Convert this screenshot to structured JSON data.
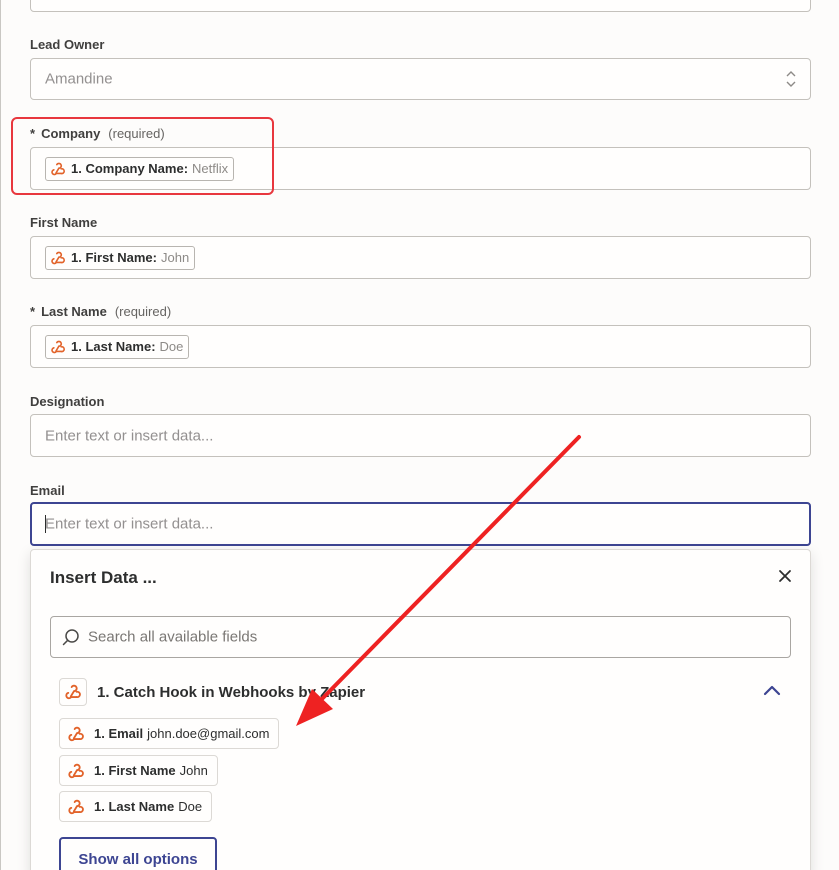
{
  "fields": {
    "lead_owner": {
      "label": "Lead Owner",
      "value": "Amandine"
    },
    "company": {
      "star": "*",
      "label": "Company",
      "required_note": "(required)",
      "pill": {
        "key": "1. Company Name:",
        "value": "Netflix"
      }
    },
    "first_name": {
      "label": "First Name",
      "pill": {
        "key": "1. First Name:",
        "value": "John"
      }
    },
    "last_name": {
      "star": "*",
      "label": "Last Name",
      "required_note": "(required)",
      "pill": {
        "key": "1. Last Name:",
        "value": "Doe"
      }
    },
    "designation": {
      "label": "Designation",
      "placeholder": "Enter text or insert data..."
    },
    "email": {
      "label": "Email",
      "placeholder": "Enter text or insert data..."
    }
  },
  "insert_data": {
    "title": "Insert Data ...",
    "search_placeholder": "Search all available fields",
    "source_title": "1. Catch Hook in Webhooks by Zapier",
    "items": [
      {
        "key": "1. Email",
        "value": "john.doe@gmail.com"
      },
      {
        "key": "1. First Name",
        "value": "John"
      },
      {
        "key": "1. Last Name",
        "value": "Doe"
      }
    ],
    "show_all_label": "Show all options"
  },
  "icons": {
    "webhook": "webhook-icon",
    "close": "close-icon",
    "search": "search-icon",
    "chevron": "chevron-up-icon",
    "select": "select-arrows-icon"
  },
  "colors": {
    "webhook_orange": "#e2632a",
    "accent_navy": "#3d4592",
    "highlight_red": "#e8373e"
  }
}
